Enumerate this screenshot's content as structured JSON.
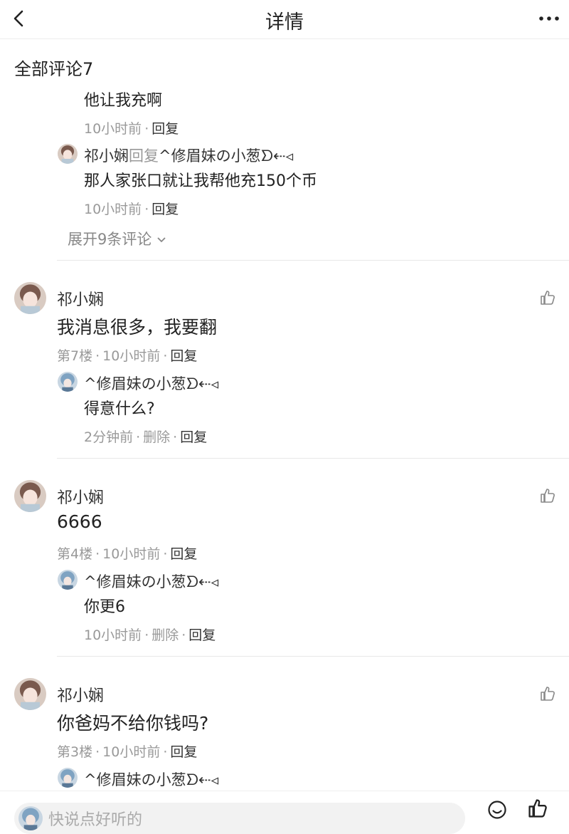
{
  "header": {
    "title": "详情",
    "back_icon": "chevron-left-icon",
    "more_icon": "more-dots-icon"
  },
  "comments_title": "全部评论7",
  "top_thread": {
    "reply1": {
      "text": "他让我充啊",
      "time": "10小时前",
      "reply_label": "回复"
    },
    "reply2": {
      "user": "祁小娴",
      "verb": "回复",
      "target": "^修眉妹の小葱ᗤ⇠◃",
      "text": "那人家张口就让我帮他充150个币",
      "time": "10小时前",
      "reply_label": "回复"
    },
    "expand_label": "展开9条评论"
  },
  "comments": [
    {
      "user": "祁小娴",
      "text": "我消息很多，我要翻",
      "floor": "第7楼",
      "time": "10小时前",
      "reply_label": "回复",
      "reply": {
        "user": "^修眉妹の小葱ᗤ⇠◃",
        "text": "得意什么?",
        "time": "2分钟前",
        "delete_label": "删除",
        "reply_label": "回复"
      }
    },
    {
      "user": "祁小娴",
      "text": "6666",
      "floor": "第4楼",
      "time": "10小时前",
      "reply_label": "回复",
      "reply": {
        "user": "^修眉妹の小葱ᗤ⇠◃",
        "text": "你更6",
        "time": "10小时前",
        "delete_label": "删除",
        "reply_label": "回复"
      }
    },
    {
      "user": "祁小娴",
      "text": "你爸妈不给你钱吗?",
      "floor": "第3楼",
      "time": "10小时前",
      "reply_label": "回复",
      "reply": {
        "user": "^修眉妹の小葱ᗤ⇠◃"
      }
    }
  ],
  "bottom_bar": {
    "placeholder": "快说点好听的",
    "emoji_icon": "emoji-icon",
    "like_icon": "thumbs-up-icon"
  },
  "colors": {
    "primary_text": "#222222",
    "secondary_text": "#999999",
    "divider": "#e8e8e8"
  }
}
